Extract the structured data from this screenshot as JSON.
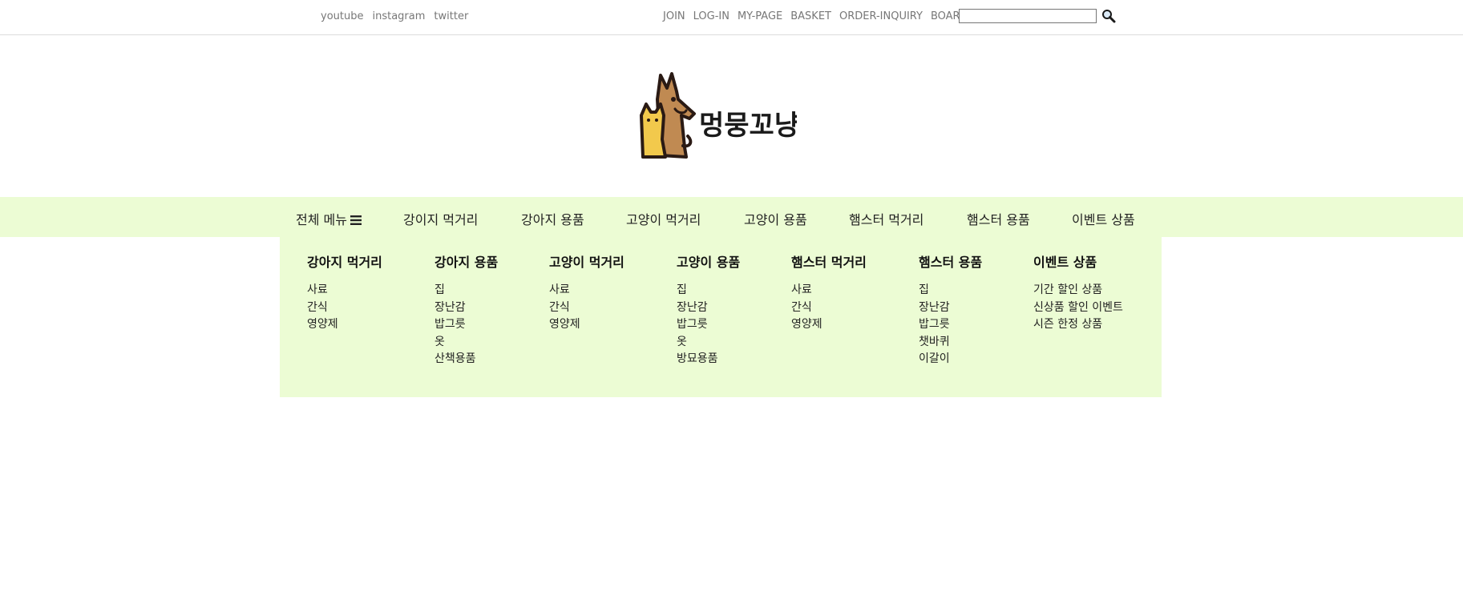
{
  "social": [
    "youtube",
    "instagram",
    "twitter"
  ],
  "util": [
    "JOIN",
    "LOG-IN",
    "MY-PAGE",
    "BASKET",
    "ORDER-INQUIRY",
    "BOARD"
  ],
  "search": {
    "value": "",
    "placeholder": ""
  },
  "icons": {
    "search": "search-icon",
    "menu": "hamburger-menu-icon",
    "logo": "dog-cat-logo"
  },
  "logo": {
    "text": "멍뭉꼬냥"
  },
  "nav": {
    "all_menu": "전체 메뉴",
    "items": [
      "강이지 먹거리",
      "강아지 용품",
      "고양이 먹거리",
      "고양이 용품",
      "햄스터 먹거리",
      "햄스터 용품",
      "이벤트 상품"
    ]
  },
  "dropdown": [
    {
      "title": "강아지 먹거리",
      "items": [
        "사료",
        "간식",
        "영양제"
      ]
    },
    {
      "title": "강아지 용품",
      "items": [
        "집",
        "장난감",
        "밥그릇",
        "옷",
        "산책용품"
      ]
    },
    {
      "title": "고양이 먹거리",
      "items": [
        "사료",
        "간식",
        "영양제"
      ]
    },
    {
      "title": "고양이 용품",
      "items": [
        "집",
        "장난감",
        "밥그릇",
        "옷",
        "방묘용품"
      ]
    },
    {
      "title": "햄스터 먹거리",
      "items": [
        "사료",
        "간식",
        "영양제"
      ]
    },
    {
      "title": "햄스터 용품",
      "items": [
        "집",
        "장난감",
        "밥그릇",
        "챗바퀴",
        "이갈이"
      ]
    },
    {
      "title": "이벤트 상품",
      "items": [
        "기간 할인 상품",
        "신상품 할인 이벤트",
        "시즌 한정 상품"
      ]
    }
  ],
  "colors": {
    "nav_bg": "#ecfcd4",
    "logo_dog": "#c08a52",
    "logo_cat": "#f2c94c",
    "outline": "#2a1a14"
  }
}
